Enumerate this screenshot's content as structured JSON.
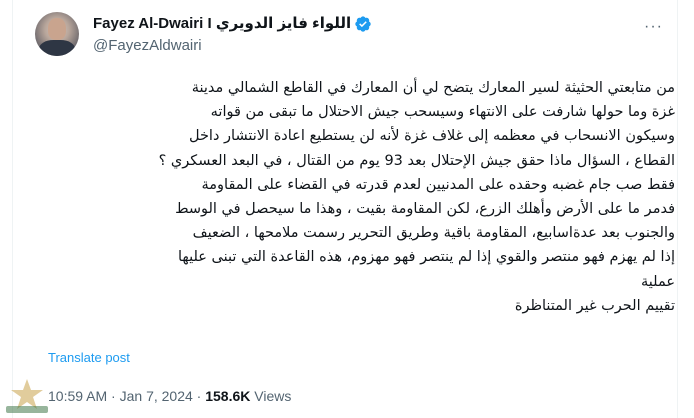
{
  "author": {
    "name": "Fayez Al-Dwairi I",
    "name_arabic": "اللواء فايز الدويري",
    "handle": "@FayezAldwairi"
  },
  "tweet": {
    "lines": [
      "من متابعتي الحثيثة لسير المعارك يتضح لي أن المعارك في القاطع الشمالي  مدينة",
      "غزة وما حولها شارفت على الانتهاء وسيسحب جيش الاحتلال ما تبقى من قواته",
      "وسيكون الانسحاب في معظمه إلى غلاف غزة لأنه لن يستطيع اعادة الانتشار داخل",
      "القطاع ، السؤال ماذا حقق جيش الإحتلال بعد 93 يوم من القتال ، في البعد العسكري ؟",
      "فقط صب جام غضبه وحقده  على المدنيين لعدم قدرته في القضاء على المقاومة",
      "فدمر ما على الأرض وأهلك الزرع، لكن المقاومة بقيت ، وهذا ما  سيحصل في الوسط",
      "والجنوب بعد  عدةاسابيع، المقاومة باقية وطريق التحرير  رسمت ملامحها ، الضعيف",
      "إذا لم يهزم فهو منتصر والقوي إذا لم ينتصر فهو مهزوم، هذه القاعدة التي تبنى عليها",
      "عملية",
      "تقييم الحرب غير المتناظرة"
    ]
  },
  "translate_label": "Translate post",
  "meta": {
    "time": "10:59 AM",
    "separator": "·",
    "date": "Jan 7, 2024",
    "views_count": "158.6K",
    "views_label": "Views"
  },
  "colors": {
    "link": "#1d9bf0",
    "secondary_text": "#536471",
    "verified": "#1d9bf0"
  }
}
